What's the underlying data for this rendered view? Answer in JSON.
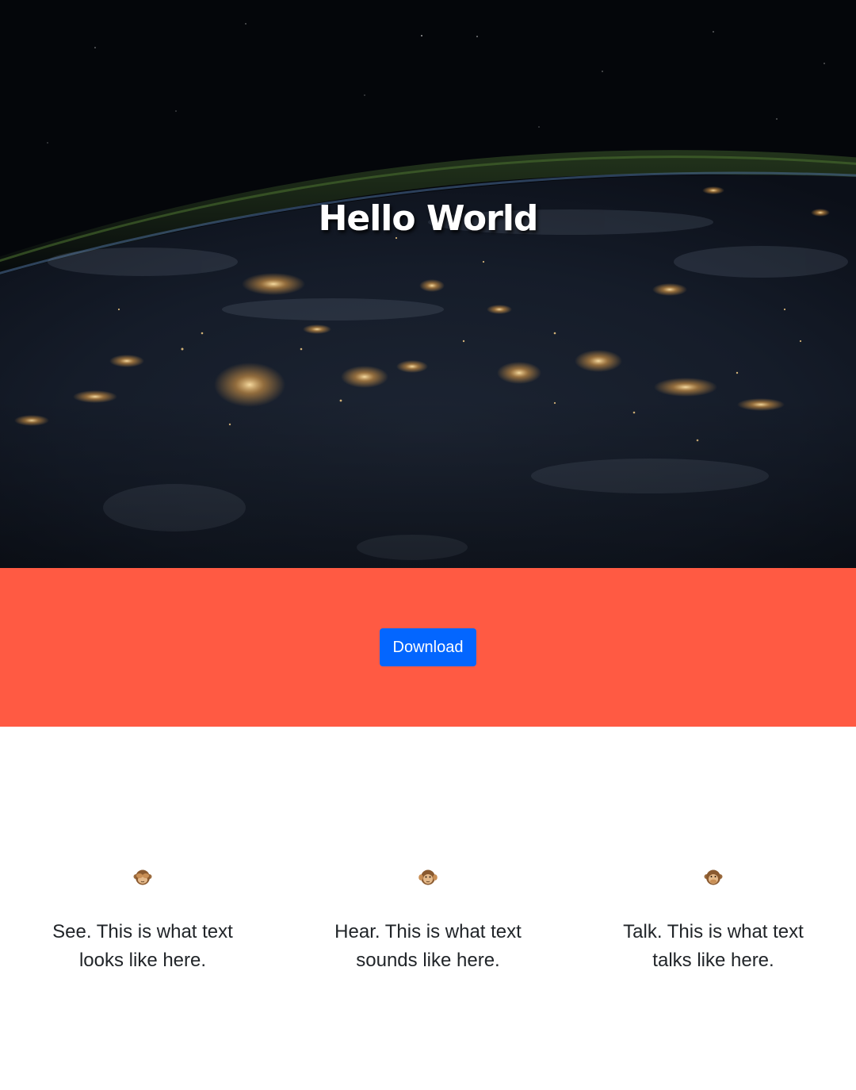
{
  "hero": {
    "title": "Hello World"
  },
  "cta": {
    "download_label": "Download"
  },
  "features": [
    {
      "icon": "see-no-evil-monkey-icon",
      "text": "See. This is what text looks like here."
    },
    {
      "icon": "hear-no-evil-monkey-icon",
      "text": "Hear. This is what text sounds like here."
    },
    {
      "icon": "speak-no-evil-monkey-icon",
      "text": "Talk. This is what text talks like here."
    }
  ],
  "colors": {
    "band_background": "#ff5a43",
    "button_background": "#0366ff",
    "hero_background": "#05070c"
  }
}
